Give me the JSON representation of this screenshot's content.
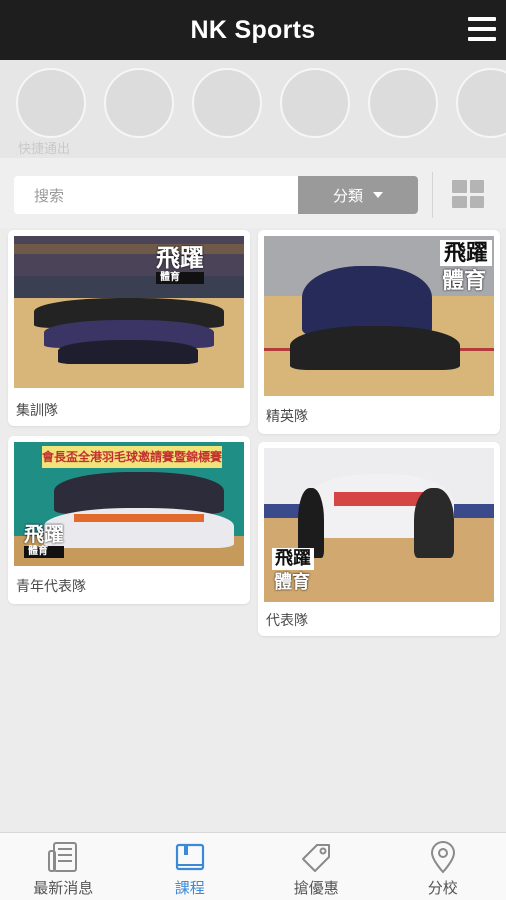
{
  "header": {
    "title": "NK Sports"
  },
  "quick_access": {
    "label": "快捷通出",
    "circle_count": 6
  },
  "search": {
    "placeholder": "搜索",
    "filter_label": "分類"
  },
  "cards": [
    {
      "label": "集訓隊",
      "brand_line1": "飛躍",
      "brand_line2": "體育"
    },
    {
      "label": "精英隊",
      "brand_line1": "飛躍",
      "brand_line2": "體育"
    },
    {
      "label": "青年代表隊",
      "brand_line1": "飛躍",
      "brand_line2": "體育",
      "banner": "會長盃全港羽毛球邀請賽暨錦標賽"
    },
    {
      "label": "代表隊",
      "brand_line1": "飛躍",
      "brand_line2": "體育"
    }
  ],
  "tabbar": {
    "items": [
      {
        "label": "最新消息",
        "icon": "newspaper-icon",
        "active": false
      },
      {
        "label": "課程",
        "icon": "book-icon",
        "active": true
      },
      {
        "label": "搶優惠",
        "icon": "tag-icon",
        "active": false
      },
      {
        "label": "分校",
        "icon": "location-pin-icon",
        "active": false
      }
    ]
  },
  "colors": {
    "header_bg": "#1e1e1e",
    "active_tab": "#3b8ad8",
    "filter_bg": "#9a9a9a"
  }
}
